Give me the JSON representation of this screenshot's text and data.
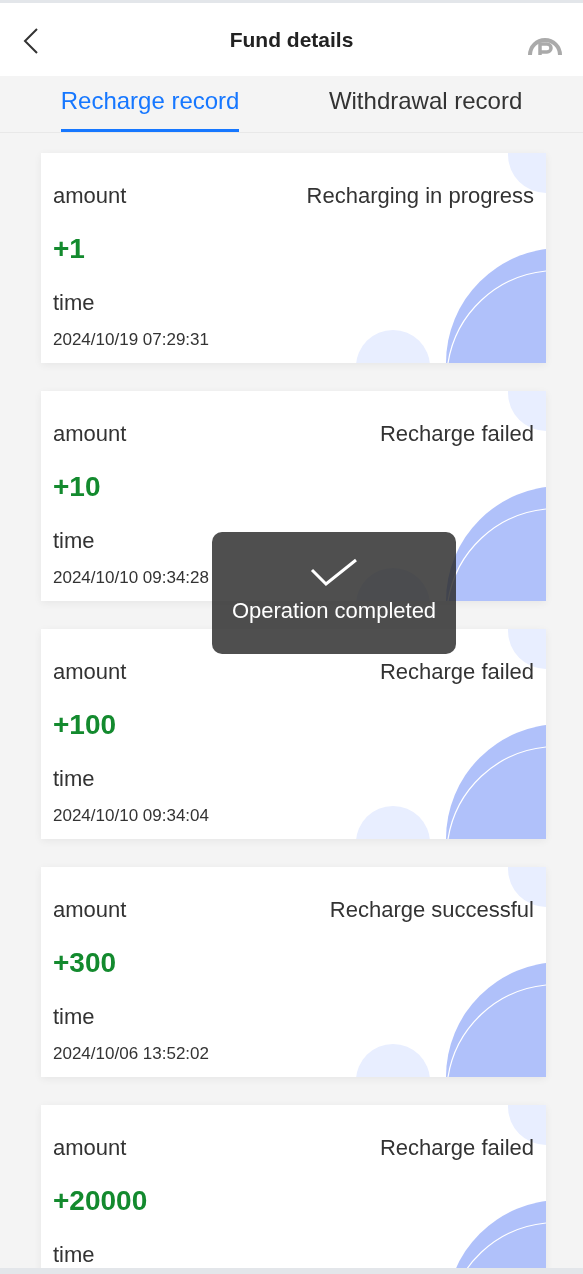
{
  "header": {
    "title": "Fund details"
  },
  "tabs": [
    {
      "label": "Recharge record",
      "selected": true
    },
    {
      "label": "Withdrawal record",
      "selected": false
    }
  ],
  "records": [
    {
      "amount_label": "amount",
      "status": "Recharging in progress",
      "amount": "+1",
      "time_label": "time",
      "time": "2024/10/19 07:29:31"
    },
    {
      "amount_label": "amount",
      "status": "Recharge failed",
      "amount": "+10",
      "time_label": "time",
      "time": "2024/10/10 09:34:28"
    },
    {
      "amount_label": "amount",
      "status": "Recharge failed",
      "amount": "+100",
      "time_label": "time",
      "time": "2024/10/10 09:34:04"
    },
    {
      "amount_label": "amount",
      "status": "Recharge successful",
      "amount": "+300",
      "time_label": "time",
      "time": "2024/10/06 13:52:02"
    },
    {
      "amount_label": "amount",
      "status": "Recharge failed",
      "amount": "+20000",
      "time_label": "time"
    }
  ],
  "toast": {
    "message": "Operation completed"
  }
}
